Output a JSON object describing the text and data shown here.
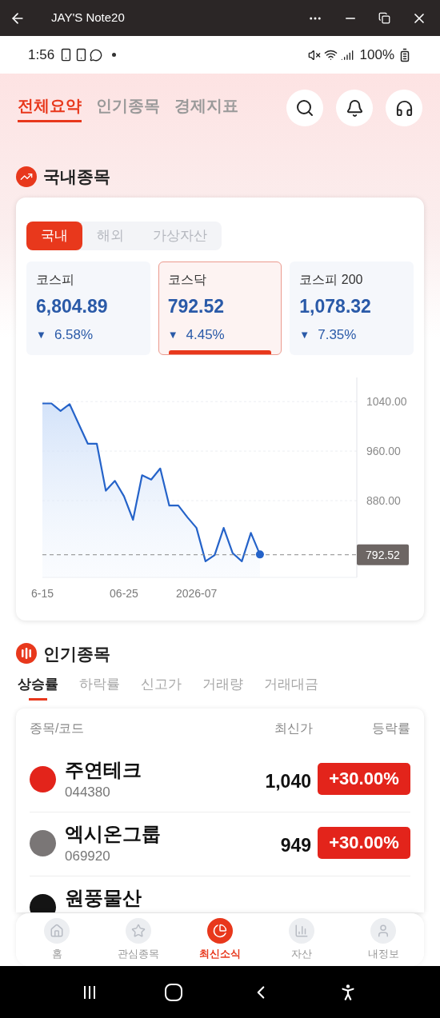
{
  "window": {
    "title": "JAY'S Note20"
  },
  "status_bar": {
    "time": "1:56",
    "battery": "100%"
  },
  "top_tabs": [
    {
      "label": "전체요약",
      "selected": true
    },
    {
      "label": "인기종목",
      "selected": false
    },
    {
      "label": "경제지표",
      "selected": false
    }
  ],
  "domestic": {
    "title": "국내종목",
    "market_tabs": [
      {
        "label": "국내",
        "selected": true
      },
      {
        "label": "해외",
        "selected": false
      },
      {
        "label": "가상자산",
        "selected": false
      }
    ],
    "indices": [
      {
        "name": "코스피",
        "value": "6,804.89",
        "arrow": "▼",
        "change": "6.58%",
        "selected": false
      },
      {
        "name": "코스닥",
        "value": "792.52",
        "arrow": "▼",
        "change": "4.45%",
        "selected": true
      },
      {
        "name": "코스피 200",
        "value": "1,078.32",
        "arrow": "▼",
        "change": "7.35%",
        "selected": false
      }
    ],
    "chart": {
      "chart_data": {
        "type": "area",
        "grid": true,
        "ref_lines": [
          {
            "axis": "y",
            "value": 792.52,
            "label": "792.52"
          }
        ],
        "categories": [
          "6-15",
          null,
          null,
          null,
          null,
          null,
          null,
          null,
          null,
          "06-25",
          null,
          null,
          null,
          null,
          null,
          null,
          null,
          "2026-07",
          null,
          null,
          null,
          null,
          null,
          null,
          null
        ],
        "series": [
          {
            "color": "#2563c9",
            "values": [
              1037,
              1037,
              1025,
              1036,
              1004,
              972,
              972,
              896,
              912,
              887,
              849,
              921,
              914,
              932,
              872,
              872,
              853,
              836,
              782,
              792,
              836,
              795,
              782,
              828,
              793
            ]
          }
        ],
        "ylim": [
          756,
          1079
        ],
        "yticks": [
          {
            "value": 1040,
            "label": "1040.00"
          },
          {
            "value": 960,
            "label": "960.00"
          },
          {
            "value": 880,
            "label": "880.00"
          }
        ]
      }
    }
  },
  "popular": {
    "title": "인기종목",
    "tabs": [
      {
        "label": "상승률",
        "selected": true
      },
      {
        "label": "하락률",
        "selected": false
      },
      {
        "label": "신고가",
        "selected": false
      },
      {
        "label": "거래량",
        "selected": false
      },
      {
        "label": "거래대금",
        "selected": false
      }
    ],
    "columns": [
      "종목/코드",
      "최신가",
      "등락률"
    ],
    "rows": [
      {
        "name": "주연테크",
        "code": "044380",
        "price": "1,040",
        "change": "+30.00%",
        "color": "#e3241b"
      },
      {
        "name": "엑시온그룹",
        "code": "069920",
        "price": "949",
        "change": "+30.00%",
        "color": "#7a7676"
      },
      {
        "name": "원풍물산",
        "color": "#141414"
      }
    ]
  },
  "bottom_nav": [
    {
      "label": "홈",
      "selected": false
    },
    {
      "label": "관심종목",
      "selected": false
    },
    {
      "label": "최신소식",
      "selected": true
    },
    {
      "label": "자산",
      "selected": false
    },
    {
      "label": "내정보",
      "selected": false
    }
  ]
}
